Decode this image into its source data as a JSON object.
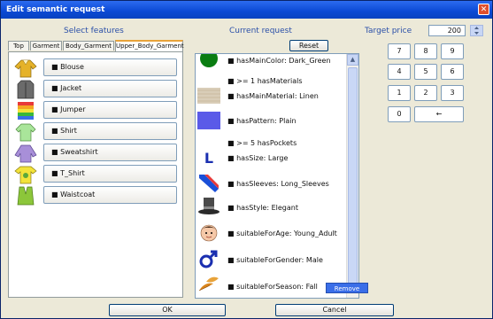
{
  "window": {
    "title": "Edit semantic request",
    "close_glyph": "✕"
  },
  "headers": {
    "select_features": "Select features",
    "current_request": "Current request",
    "target_price": "Target price"
  },
  "tabs": [
    {
      "label": "Top"
    },
    {
      "label": "Garment"
    },
    {
      "label": "Body_Garment"
    },
    {
      "label": "Upper_Body_Garment"
    }
  ],
  "features": [
    {
      "label": "Blouse",
      "icon": "blouse-icon"
    },
    {
      "label": "Jacket",
      "icon": "jacket-icon"
    },
    {
      "label": "Jumper",
      "icon": "jumper-icon"
    },
    {
      "label": "Shirt",
      "icon": "shirt-icon"
    },
    {
      "label": "Sweatshirt",
      "icon": "sweatshirt-icon"
    },
    {
      "label": "T_Shirt",
      "icon": "t-shirt-icon"
    },
    {
      "label": "Waistcoat",
      "icon": "waistcoat-icon"
    }
  ],
  "bullet": "■",
  "reset_label": "Reset",
  "requests": [
    {
      "text": "hasMainColor: Dark_Green",
      "icon": "green-circle-icon"
    },
    {
      "text": ">= 1 hasMaterials",
      "icon": ""
    },
    {
      "text": "hasMainMaterial: Linen",
      "icon": "linen-texture-icon"
    },
    {
      "text": "hasPattern: Plain",
      "icon": "plain-pattern-icon"
    },
    {
      "text": ">= 5 hasPockets",
      "icon": ""
    },
    {
      "text": "hasSize: Large",
      "icon": "size-l-icon"
    },
    {
      "text": "hasSleeves: Long_Sleeves",
      "icon": "long-sleeves-icon"
    },
    {
      "text": "hasStyle: Elegant",
      "icon": "top-hat-icon"
    },
    {
      "text": "suitableForAge: Young_Adult",
      "icon": "young-adult-face-icon"
    },
    {
      "text": "suitableForGender: Male",
      "icon": "male-symbol-icon"
    },
    {
      "text": "suitableForSeason: Fall",
      "icon": "fall-leaves-icon"
    }
  ],
  "size_letter": "L",
  "remove_label": "Remove",
  "price": {
    "value": "200"
  },
  "keypad": [
    "7",
    "8",
    "9",
    "4",
    "5",
    "6",
    "1",
    "2",
    "3",
    "0",
    "←"
  ],
  "ok_label": "OK",
  "cancel_label": "Cancel",
  "colors": {
    "title_bar": "#0b49d4",
    "accent": "#2a4fa8",
    "dark_green": "#0a7d12",
    "plain_pattern": "#5a5ae8",
    "tab_highlight": "#e8a33a"
  }
}
